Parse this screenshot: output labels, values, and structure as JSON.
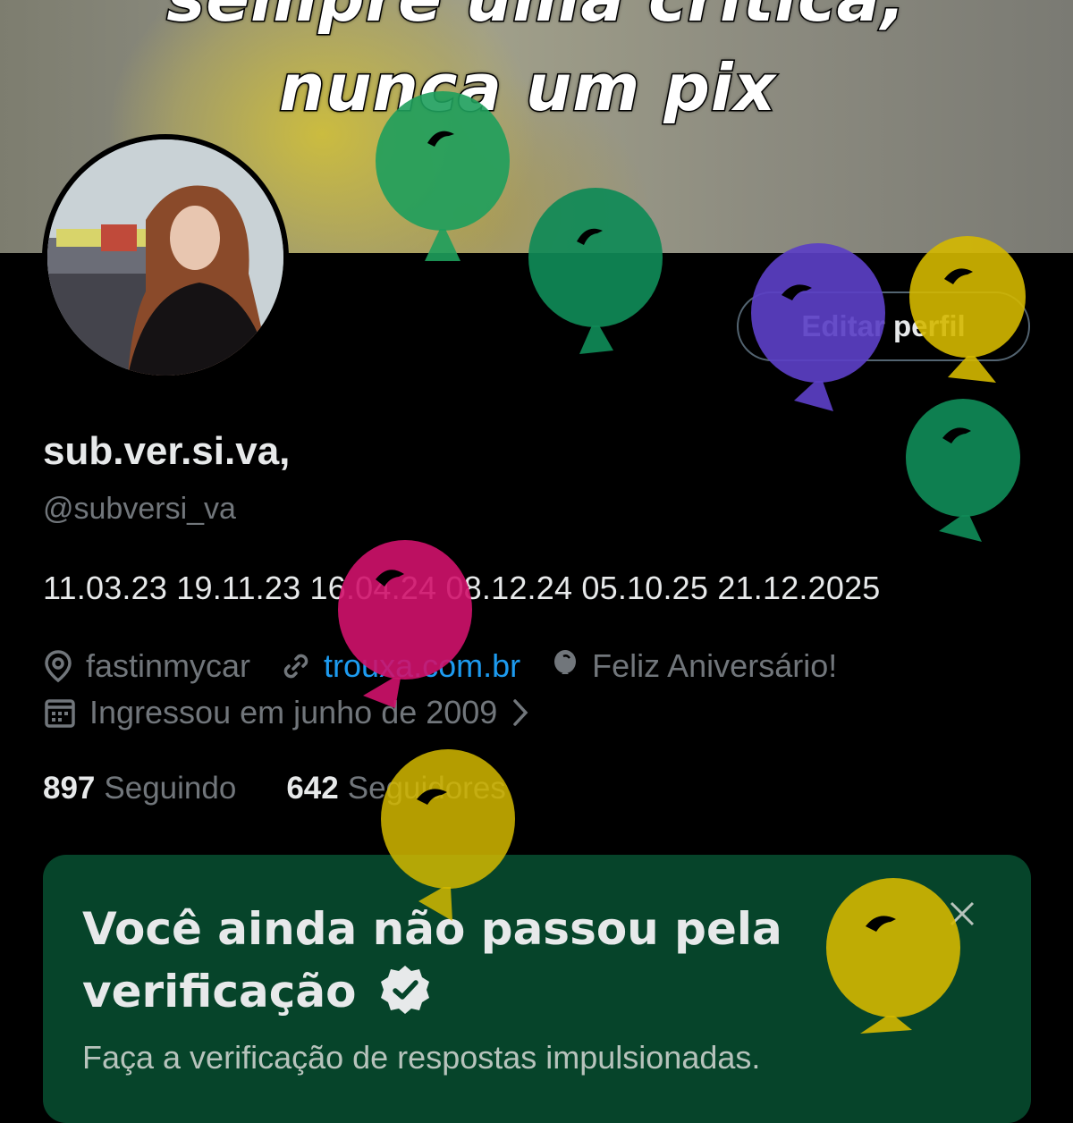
{
  "banner": {
    "line1": "sempre uma crítica,",
    "line2": "nunca um pix"
  },
  "profile": {
    "edit_button": "Editar perfil",
    "display_name": "sub.ver.si.va,",
    "handle": "@subversi_va",
    "bio": "11.03.23 19.11.23 16.04.24 08.12.24 05.10.25 21.12.2025",
    "location": "fastinmycar",
    "website": "trouxa.com.br",
    "birthday": "Feliz Aniversário!",
    "joined": "Ingressou em junho de 2009"
  },
  "stats": {
    "following_count": "897",
    "following_label": "Seguindo",
    "followers_count": "642",
    "followers_label": "Seguidores"
  },
  "verification": {
    "title": "Você ainda não passou pela verificação",
    "subtitle": "Faça a verificação de respostas impulsionadas."
  },
  "colors": {
    "background": "#000000",
    "text_primary": "#e7e9ea",
    "text_secondary": "#71767b",
    "link": "#1d9bf0",
    "verify_card": "#06442a",
    "balloon_green": "#1e9e5c",
    "balloon_purple": "#5b3fc4",
    "balloon_yellow": "#d4b800",
    "balloon_pink": "#d0126b"
  }
}
